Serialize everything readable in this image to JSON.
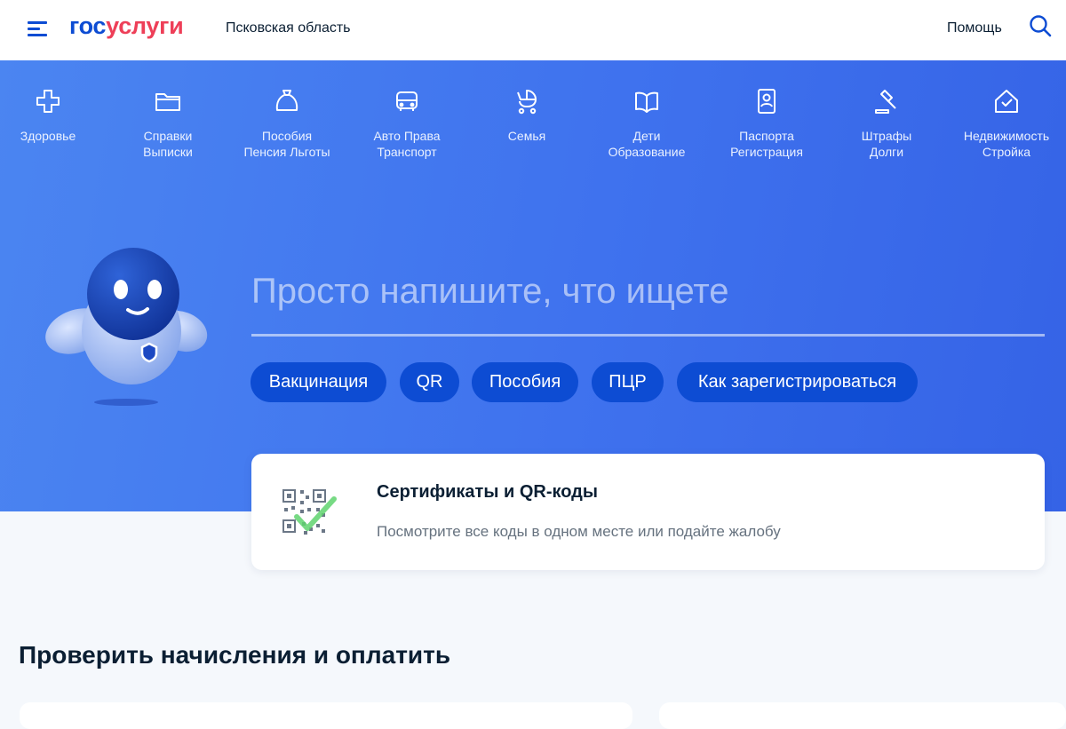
{
  "header": {
    "logo_part1": "гос",
    "logo_part2": "услуги",
    "region": "Псковская область",
    "help_label": "Помощь"
  },
  "categories": [
    {
      "line1": "Здоровье",
      "line2": "",
      "icon": "health-cross-icon"
    },
    {
      "line1": "Справки",
      "line2": "Выписки",
      "icon": "folder-icon"
    },
    {
      "line1": "Пособия",
      "line2": "Пенсия Льготы",
      "icon": "money-bag-icon"
    },
    {
      "line1": "Авто Права",
      "line2": "Транспорт",
      "icon": "car-icon"
    },
    {
      "line1": "Семья",
      "line2": "",
      "icon": "stroller-icon"
    },
    {
      "line1": "Дети",
      "line2": "Образование",
      "icon": "book-icon"
    },
    {
      "line1": "Паспорта",
      "line2": "Регистрация",
      "icon": "passport-icon"
    },
    {
      "line1": "Штрафы",
      "line2": "Долги",
      "icon": "gavel-icon"
    },
    {
      "line1": "Недвижимость",
      "line2": "Стройка",
      "icon": "house-icon"
    }
  ],
  "search": {
    "placeholder": "Просто напишите, что ищете",
    "chips": [
      "Вакцинация",
      "QR",
      "Пособия",
      "ПЦР",
      "Как зарегистрироваться"
    ]
  },
  "promo_card": {
    "title": "Сертификаты и QR-коды",
    "subtitle": "Посмотрите все коды в одном месте или подайте жалобу",
    "icon": "qr-code-check-icon"
  },
  "section": {
    "title": "Проверить начисления и оплатить"
  },
  "colors": {
    "brand_blue": "#0d4cd3",
    "brand_red": "#ee3f58",
    "hero_gradient_start": "#4b85f1",
    "hero_gradient_end": "#3563e6"
  }
}
